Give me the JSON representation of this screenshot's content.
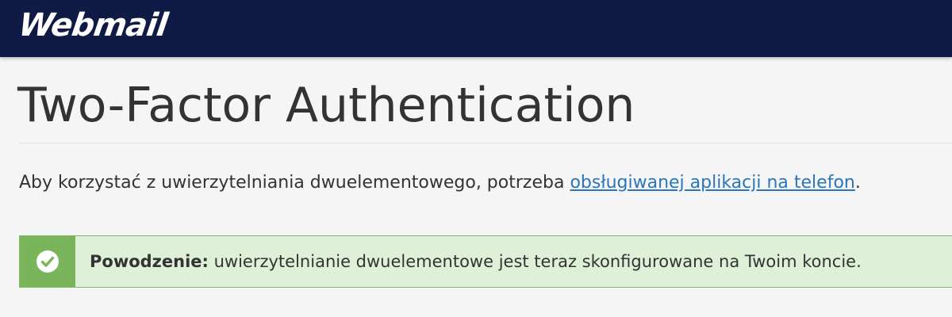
{
  "header": {
    "logo_text": "Webmail"
  },
  "main": {
    "title": "Two-Factor Authentication",
    "intro_text": "Aby korzystać z uwierzytelniania dwuelementowego, potrzeba ",
    "intro_link": "obsługiwanej aplikacji na telefon",
    "intro_end": "."
  },
  "alert": {
    "icon": "check-circle-icon",
    "label": "Powodzenie:",
    "message": " uwierzytelnianie dwuelementowe jest teraz skonfigurowane na Twoim koncie.",
    "colors": {
      "background": "#dff0d8",
      "icon_box": "#7ab55c"
    }
  },
  "colors": {
    "header_bg": "#0f1a45",
    "link": "#2a76b8"
  }
}
